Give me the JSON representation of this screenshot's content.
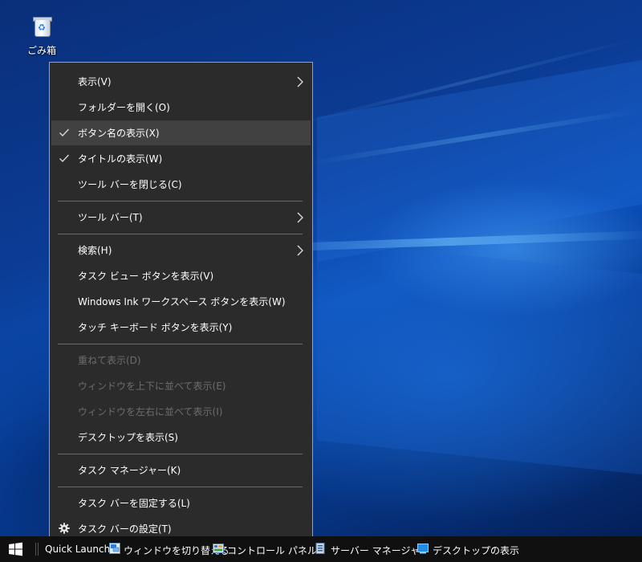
{
  "desktop": {
    "recycle_bin_label": "ごみ箱"
  },
  "context_menu": {
    "groups": [
      [
        {
          "label": "表示(V)",
          "submenu": true
        },
        {
          "label": "フォルダーを開く(O)"
        },
        {
          "label": "ボタン名の表示(X)",
          "checked": true,
          "highlighted": true
        },
        {
          "label": "タイトルの表示(W)",
          "checked": true
        },
        {
          "label": "ツール バーを閉じる(C)"
        }
      ],
      [
        {
          "label": "ツール バー(T)",
          "submenu": true
        }
      ],
      [
        {
          "label": "検索(H)",
          "submenu": true
        },
        {
          "label": "タスク ビュー ボタンを表示(V)"
        },
        {
          "label": "Windows Ink ワークスペース ボタンを表示(W)"
        },
        {
          "label": "タッチ キーボード ボタンを表示(Y)"
        }
      ],
      [
        {
          "label": "重ねて表示(D)",
          "disabled": true
        },
        {
          "label": "ウィンドウを上下に並べて表示(E)",
          "disabled": true
        },
        {
          "label": "ウィンドウを左右に並べて表示(I)",
          "disabled": true
        },
        {
          "label": "デスクトップを表示(S)"
        }
      ],
      [
        {
          "label": "タスク マネージャー(K)"
        }
      ],
      [
        {
          "label": "タスク バーを固定する(L)"
        },
        {
          "label": "タスク バーの設定(T)",
          "icon": "gear-icon"
        }
      ]
    ]
  },
  "taskbar": {
    "quick_launch": "Quick Launch",
    "items": [
      {
        "label": "ウィンドウを切り替える",
        "icon": "switch-windows-icon"
      },
      {
        "label": "コントロール パネル",
        "icon": "control-panel-icon"
      },
      {
        "label": "サーバー マネージャー",
        "icon": "server-manager-icon"
      },
      {
        "label": "デスクトップの表示",
        "icon": "show-desktop-icon"
      }
    ]
  },
  "colors": {
    "menu_bg": "#2b2b2b",
    "menu_highlight": "#414141",
    "menu_disabled_text": "#6d6d6d",
    "taskbar_bg": "#101010"
  }
}
